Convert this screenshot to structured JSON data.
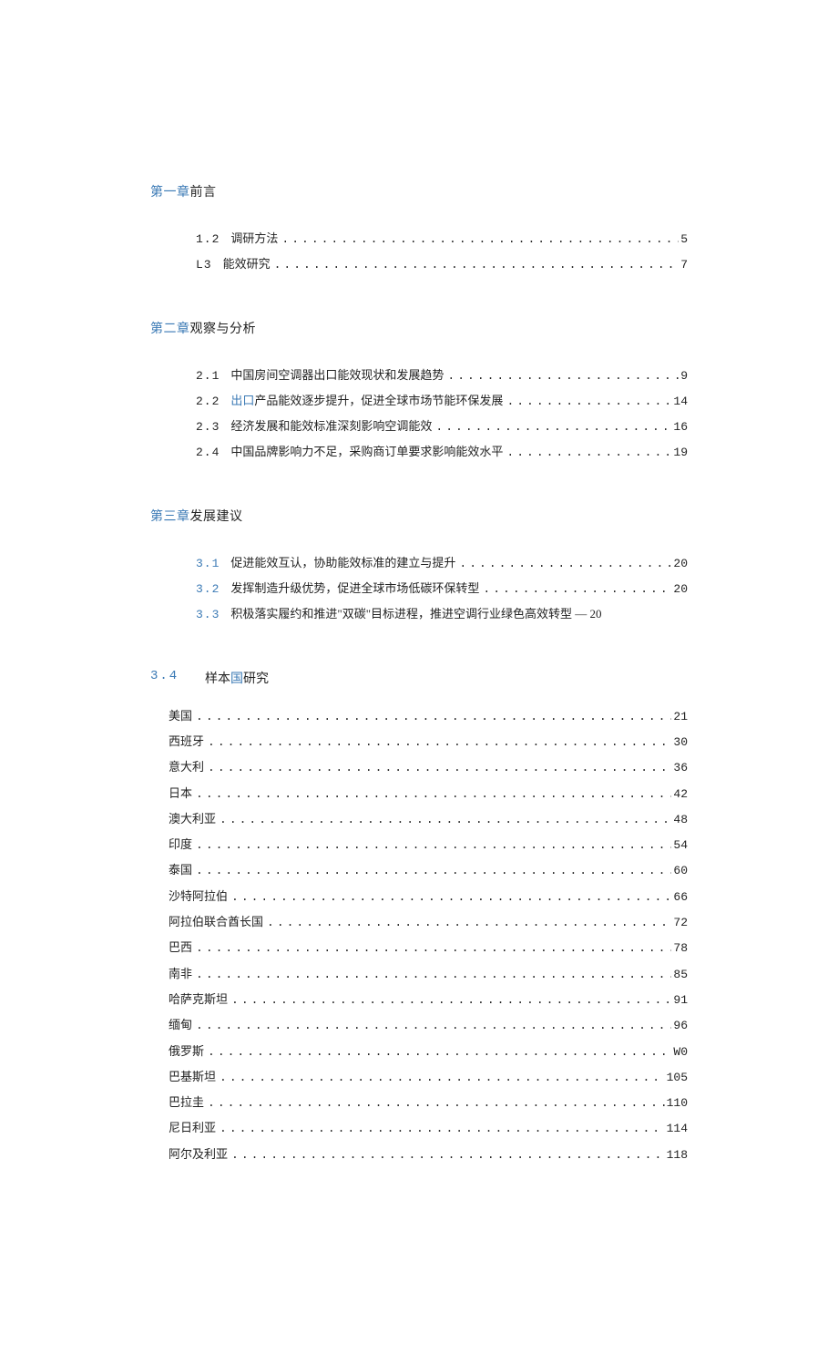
{
  "chapter1": {
    "heading_blue": "第一章",
    "heading_black": "前言",
    "items": [
      {
        "num": "1.2",
        "title": "调研方法",
        "page": "5"
      },
      {
        "num": "L3",
        "title": "能效研究",
        "page": "7"
      }
    ]
  },
  "chapter2": {
    "heading_blue": "第二章",
    "heading_black": "观察与分析",
    "items": [
      {
        "num": "2.1",
        "title": "中国房间空调器出口能效现状和发展趋势",
        "page": "9"
      },
      {
        "num": "2.2",
        "title_blue": "出口",
        "title_rest": "产品能效逐步提升，促进全球市场节能环保发展",
        "page": "14"
      },
      {
        "num": "2.3",
        "title": "经济发展和能效标准深刻影响空调能效",
        "page": "16"
      },
      {
        "num": "2.4",
        "title": "中国品牌影响力不足，采购商订单要求影响能效水平",
        "page": "19"
      }
    ]
  },
  "chapter3": {
    "heading_blue": "第三章",
    "heading_black": "发展建议",
    "items": [
      {
        "num": "3.1",
        "title": "促进能效互认，协助能效标准的建立与提升",
        "page": "20"
      },
      {
        "num": "3.2",
        "title": "发挥制造升级优势，促进全球市场低碳环保转型",
        "page": "20"
      },
      {
        "num": "3.3",
        "title": "积极落实履约和推进\"双碳\"目标进程，推进空调行业绿色高效转型 — 20",
        "no_leader": true
      }
    ]
  },
  "section34": {
    "num": "3.4",
    "title_black1": "样本",
    "title_blue": "国",
    "title_black2": "研究",
    "countries": [
      {
        "name": "美国",
        "page": "21"
      },
      {
        "name": "西班牙",
        "page": "30"
      },
      {
        "name": "意大利",
        "page": "36"
      },
      {
        "name": "日本",
        "page": "42"
      },
      {
        "name": "澳大利亚",
        "page": "48"
      },
      {
        "name": "印度",
        "page": "54"
      },
      {
        "name": "泰国",
        "page": "60"
      },
      {
        "name": "沙特阿拉伯",
        "page": "66"
      },
      {
        "name": "阿拉伯联合酋长国",
        "page": "72"
      },
      {
        "name": "巴西",
        "page": "78"
      },
      {
        "name": "南非",
        "page": "85"
      },
      {
        "name": "哈萨克斯坦",
        "page": "91"
      },
      {
        "name": "缅甸",
        "page": "96"
      },
      {
        "name": "俄罗斯",
        "page": "W0"
      },
      {
        "name": "巴基斯坦",
        "page": "105"
      },
      {
        "name": "巴拉圭",
        "page": "110"
      },
      {
        "name": "尼日利亚",
        "page": "114"
      },
      {
        "name": "阿尔及利亚",
        "page": "118"
      }
    ]
  }
}
